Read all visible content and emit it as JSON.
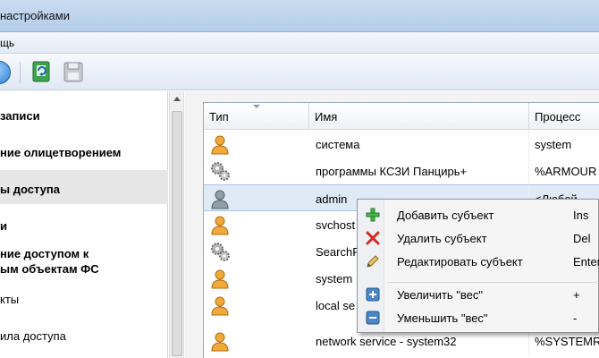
{
  "window": {
    "title": "настройками"
  },
  "menu": {
    "items": [
      "щь"
    ]
  },
  "toolbar": {
    "refresh_icon": "refresh-policy-icon",
    "save_icon": "floppy-save-icon"
  },
  "nav": {
    "items": [
      {
        "label": "записи",
        "bold": true
      },
      {
        "label": "ние олицетворением",
        "bold": true
      },
      {
        "label": "ы доступа",
        "bold": true,
        "selected": true
      },
      {
        "label": "и",
        "bold": true
      },
      {
        "label": "ние доступом к",
        "bold": true
      },
      {
        "label": "ым объектам ФС",
        "bold": true
      },
      {
        "label": "кты",
        "bold": false
      },
      {
        "label": "ила доступа",
        "bold": false
      }
    ]
  },
  "grid": {
    "headers": {
      "type": "Тип",
      "name": "Имя",
      "process": "Процесс"
    },
    "rows": [
      {
        "icon": "user-icon",
        "name": "система",
        "process": "system"
      },
      {
        "icon": "gears-icon",
        "name": "программы КСЗИ Панцирь+",
        "process": "%ARMOUR"
      },
      {
        "icon": "user-gray-icon",
        "name": "admin",
        "process": "<Любой",
        "selected": true
      },
      {
        "icon": "user-icon",
        "name": "svchost",
        "process": ""
      },
      {
        "icon": "gears-icon",
        "name": "SearchP",
        "process": ""
      },
      {
        "icon": "user-icon",
        "name": "system",
        "process": ""
      },
      {
        "icon": "user-icon",
        "name": "local se",
        "process": ""
      },
      {
        "icon": "user-icon",
        "name": "network service - system32",
        "process": "%SYSTEMR"
      }
    ]
  },
  "context_menu": {
    "items": [
      {
        "icon": "plus-green-icon",
        "label": "Добавить субъект",
        "shortcut": "Ins"
      },
      {
        "icon": "delete-x-icon",
        "label": "Удалить субъект",
        "shortcut": "Del"
      },
      {
        "icon": "edit-pencil-icon",
        "label": "Редактировать субъект",
        "shortcut": "Enter"
      },
      {
        "icon": "increase-weight-icon",
        "label": "Увеличить \"вес\"",
        "shortcut": "+"
      },
      {
        "icon": "decrease-weight-icon",
        "label": "Уменьшить \"вес\"",
        "shortcut": "-"
      }
    ]
  },
  "colors": {
    "accent": "#2d7fd1",
    "selection": "#dfeaf7",
    "titlebar": "#c9dcf0"
  }
}
